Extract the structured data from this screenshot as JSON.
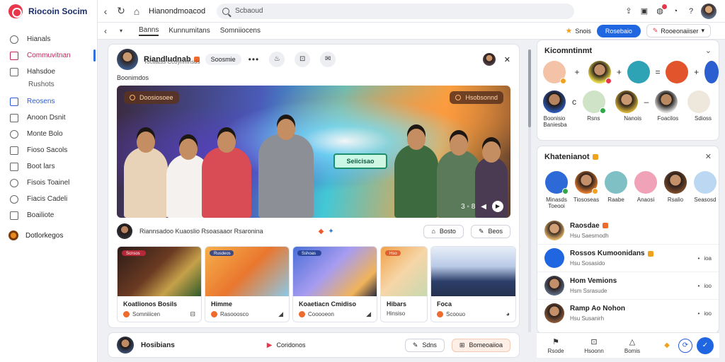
{
  "app": {
    "name": "Riocoin Socim"
  },
  "sidebar": {
    "items": [
      {
        "label": "Hianals",
        "icon": "heart-icon"
      },
      {
        "label": "Commuvitnan",
        "icon": "calendar-icon",
        "active": true
      },
      {
        "label": "Hahsdoe",
        "icon": "id-icon",
        "sub": "Rushots"
      },
      {
        "label": "Reosens",
        "icon": "grid-icon",
        "blue": true
      },
      {
        "label": "Anoon Dsnit",
        "icon": "play-icon"
      },
      {
        "label": "Monte Bolo",
        "icon": "clock-icon"
      },
      {
        "label": "Fioso Sacols",
        "icon": "chat-icon"
      },
      {
        "label": "Boot lars",
        "icon": "grid-icon"
      },
      {
        "label": "Fisois Toainel",
        "icon": "arrow-icon"
      },
      {
        "label": "Fiacis Cadeli",
        "icon": "bell-icon"
      },
      {
        "label": "Boailiote",
        "icon": "doc-icon"
      }
    ],
    "group_label": "Dotlorkegos"
  },
  "topbar": {
    "title": "Hianondmoacod",
    "search_placeholder": "Scbaoud"
  },
  "subnav": {
    "tabs": [
      "Banns",
      "Kunnumitans",
      "Somniiocens"
    ],
    "active_tab": 0,
    "label_small": "Snois",
    "primary_button": "Rosebaio",
    "select_value": "Rooeonaiiser"
  },
  "post": {
    "author": "Riandludnab",
    "subline": "Toctiatss Ccoyrimhsds",
    "follow_label": "Soosmie",
    "caption": "Boonimdos",
    "hero_chip_left": "Doosiosoee",
    "hero_chip_right": "Hsobsonnd",
    "hero_sign": "Seiicisao",
    "hero_counter": "3 ◦ 8",
    "byline": "Riannsadoo Kuaoslio Rsoasaaor Rsaronina",
    "action_1": "Bosto",
    "action_2": "Beos",
    "thumbs": [
      {
        "title": "Koatlionos Bosils",
        "meta": "Somniiicen",
        "tag": "Scnsos"
      },
      {
        "title": "Himme",
        "meta": "Rasooosco",
        "tag": "Rusdeos"
      },
      {
        "title": "Koaetiacn Cmidiso",
        "meta": "Cooooeon",
        "tag": "Sshoas"
      },
      {
        "title": "Hibars",
        "meta": "Hinsiso",
        "tag": "Hso"
      },
      {
        "title": "Foca",
        "meta": "Scoouo",
        "tag": ""
      }
    ]
  },
  "post2": {
    "name": "Hosibians",
    "link": "Coridonos",
    "action_1": "Sdns",
    "action_2": "Bomeoaiioa"
  },
  "right_top": {
    "title": "Kicomntinmt",
    "captions": [
      "Boonisio",
      "Rsns",
      "Nanois",
      "Baniesba",
      "Foacilos",
      "Sdioss"
    ]
  },
  "right_friends": {
    "title": "Khatenianot",
    "friends": [
      {
        "label": "Minasds Toeooi"
      },
      {
        "label": "Tiososeas"
      },
      {
        "label": "Raabe"
      },
      {
        "label": "Anaosi"
      },
      {
        "label": "Rsalio"
      },
      {
        "label": "Seasosd"
      }
    ],
    "list": [
      {
        "title": "Raosdae",
        "sub": "Hsu Saesmodh",
        "right": ""
      },
      {
        "title": "Rossos Kumoonidans",
        "sub": "Hsu Sosasido",
        "right": "ioa"
      },
      {
        "title": "Hom Vemions",
        "sub": "Hsm Ssrasude",
        "right": "ioo"
      },
      {
        "title": "Ramp Ao Nohon",
        "sub": "Hsu Susanirh",
        "right": "ioo"
      }
    ]
  },
  "dock": {
    "items": [
      "Rsode",
      "Hsoonn",
      "Bomis"
    ]
  },
  "colors": {
    "accent": "#1f66e0",
    "brand": "#e8364a",
    "active_nav": "#c0245a"
  }
}
